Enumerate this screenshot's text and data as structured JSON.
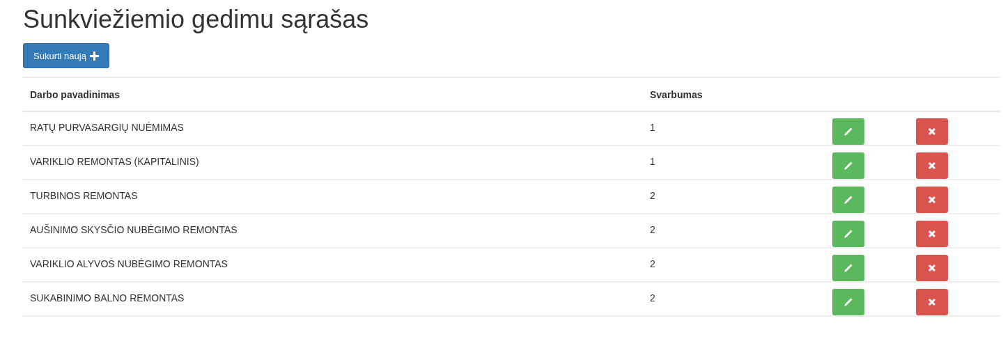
{
  "title": "Sunkviežiemio gedimu sąrašas",
  "create_button": {
    "label": "Sukurti naują"
  },
  "table": {
    "columns": [
      "Darbo pavadinimas",
      "Svarbumas"
    ],
    "rows": [
      {
        "name": "RATŲ PURVASARGIŲ NUĖMIMAS",
        "priority": "1"
      },
      {
        "name": "VARIKLIO REMONTAS (KAPITALINIS)",
        "priority": "1"
      },
      {
        "name": "TURBINOS REMONTAS",
        "priority": "2"
      },
      {
        "name": "AUŠINIMO SKYSČIO NUBĖGIMO REMONTAS",
        "priority": "2"
      },
      {
        "name": "VARIKLIO ALYVOS NUBĖGIMO REMONTAS",
        "priority": "2"
      },
      {
        "name": "SUKABINIMO BALNO REMONTAS",
        "priority": "2"
      }
    ]
  }
}
